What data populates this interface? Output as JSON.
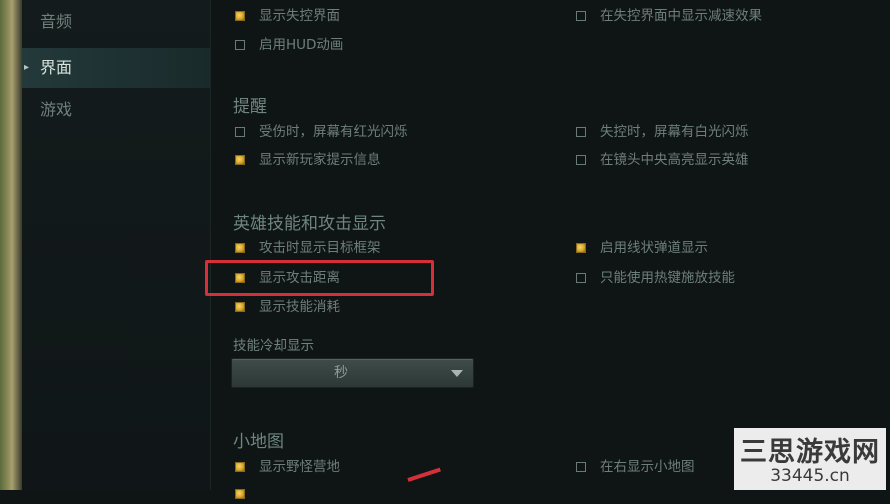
{
  "sidebar": {
    "items": [
      {
        "label": "音频",
        "active": false
      },
      {
        "label": "界面",
        "active": true
      },
      {
        "label": "游戏",
        "active": false
      }
    ],
    "active_marker": "▸"
  },
  "main": {
    "top_options": [
      {
        "label": "显示失控界面",
        "checked": true
      },
      {
        "label": "启用HUD动画",
        "checked": false
      },
      {
        "label": "在失控界面中显示减速效果",
        "checked": false
      }
    ],
    "reminders": {
      "title": "提醒",
      "options": [
        {
          "label": "受伤时，屏幕有红光闪烁",
          "checked": false
        },
        {
          "label": "显示新玩家提示信息",
          "checked": true
        },
        {
          "label": "失控时，屏幕有白光闪烁",
          "checked": false
        },
        {
          "label": "在镜头中央高亮显示英雄",
          "checked": false
        }
      ]
    },
    "hero_skills": {
      "title": "英雄技能和攻击显示",
      "options": [
        {
          "label": "攻击时显示目标框架",
          "checked": true
        },
        {
          "label": "显示攻击距离",
          "checked": true,
          "highlighted": true
        },
        {
          "label": "显示技能消耗",
          "checked": true
        },
        {
          "label": "启用线状弹道显示",
          "checked": true
        },
        {
          "label": "只能使用热键施放技能",
          "checked": false
        }
      ],
      "cooldown_label": "技能冷却显示",
      "cooldown_value": "秒"
    },
    "minimap": {
      "title": "小地图",
      "options": [
        {
          "label": "显示野怪营地",
          "checked": true
        },
        {
          "label": "在右显示小地图",
          "checked": false
        }
      ]
    }
  },
  "watermark": {
    "line1": "三思游戏网",
    "line2": "33445.cn"
  },
  "colors": {
    "highlight": "#d5303a",
    "checkbox_checked": "#d8a92c",
    "sidebar_active": "#23393a"
  }
}
